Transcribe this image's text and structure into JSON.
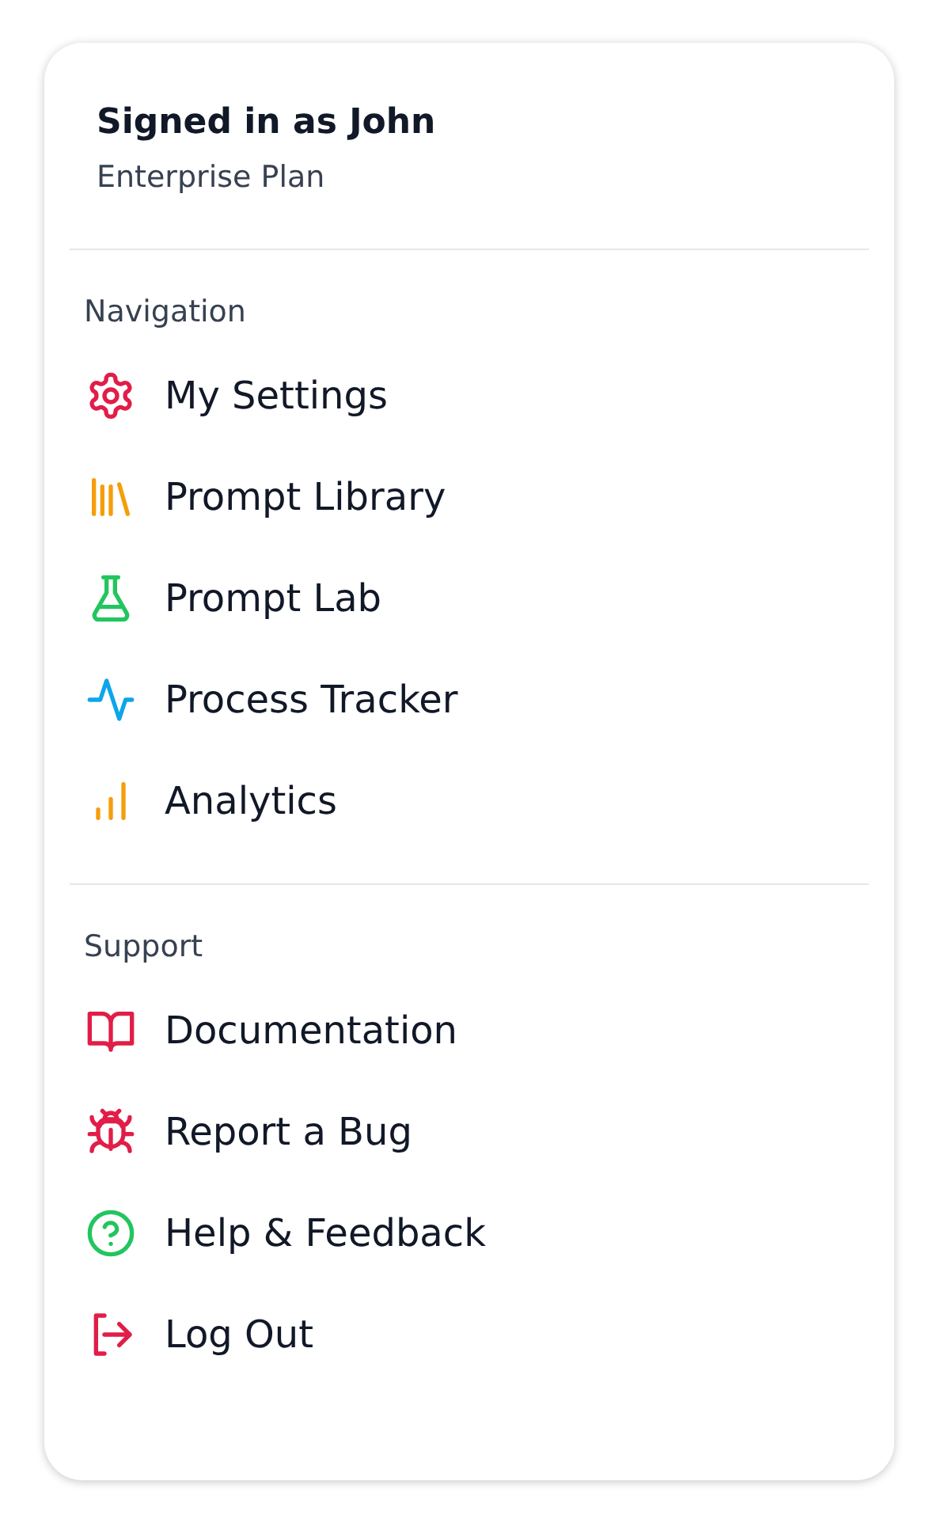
{
  "header": {
    "title": "Signed in as John",
    "subtitle": "Enterprise Plan"
  },
  "sections": [
    {
      "label": "Navigation",
      "items": [
        {
          "label": "My Settings",
          "kind": "gear",
          "color": "#e11d48"
        },
        {
          "label": "Prompt Library",
          "kind": "library",
          "color": "#f59e0b"
        },
        {
          "label": "Prompt Lab",
          "kind": "flask",
          "color": "#22c55e"
        },
        {
          "label": "Process Tracker",
          "kind": "pulse",
          "color": "#0ea5e9"
        },
        {
          "label": "Analytics",
          "kind": "bars",
          "color": "#f59e0b"
        }
      ]
    },
    {
      "label": "Support",
      "items": [
        {
          "label": "Documentation",
          "kind": "book",
          "color": "#e11d48"
        },
        {
          "label": "Report a Bug",
          "kind": "bug",
          "color": "#e11d48"
        },
        {
          "label": "Help & Feedback",
          "kind": "help",
          "color": "#22c55e"
        },
        {
          "label": "Log Out",
          "kind": "logout",
          "color": "#e11d48"
        }
      ]
    }
  ]
}
